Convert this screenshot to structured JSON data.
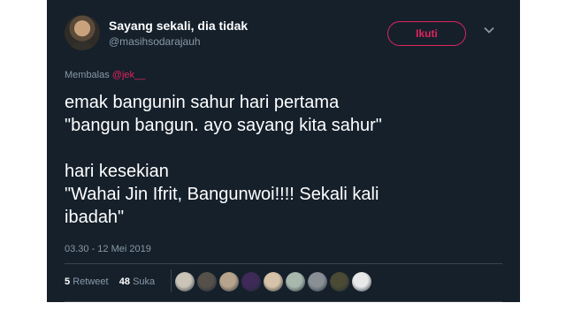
{
  "tweet": {
    "display_name": "Sayang sekali, dia tidak",
    "handle": "@masihsodarajauh",
    "follow_label": "Ikuti",
    "reply_prefix": "Membalas",
    "reply_mention": "@jek__",
    "text": "emak bangunin sahur hari pertama\n\"bangun bangun. ayo sayang kita sahur\"\n\nhari kesekian\n\"Wahai Jin Ifrit, Bangunwoi!!!! Sekali kali\nibadah\"",
    "timestamp": "03.30 - 12 Mei 2019",
    "retweets_count": "5",
    "retweets_label": "Retweet",
    "likes_count": "48",
    "likes_label": "Suka"
  },
  "likers": [
    {
      "name": "liker-1",
      "color": "#c9c3b8"
    },
    {
      "name": "liker-2",
      "color": "#55504a"
    },
    {
      "name": "liker-3",
      "color": "#b7a48c"
    },
    {
      "name": "liker-4",
      "color": "#3e2a57"
    },
    {
      "name": "liker-5",
      "color": "#d6c2a8"
    },
    {
      "name": "liker-6",
      "color": "#a9b8ad"
    },
    {
      "name": "liker-7",
      "color": "#8a8f95"
    },
    {
      "name": "liker-8",
      "color": "#4b4a35"
    },
    {
      "name": "liker-9",
      "color": "#e8e8e8"
    }
  ],
  "colors": {
    "background": "#15202b",
    "accent": "#e0245e",
    "muted": "#8899a6",
    "divider": "#38444d"
  },
  "icons": {
    "avatar": "profile-photo",
    "menu": "chevron-down-icon"
  }
}
